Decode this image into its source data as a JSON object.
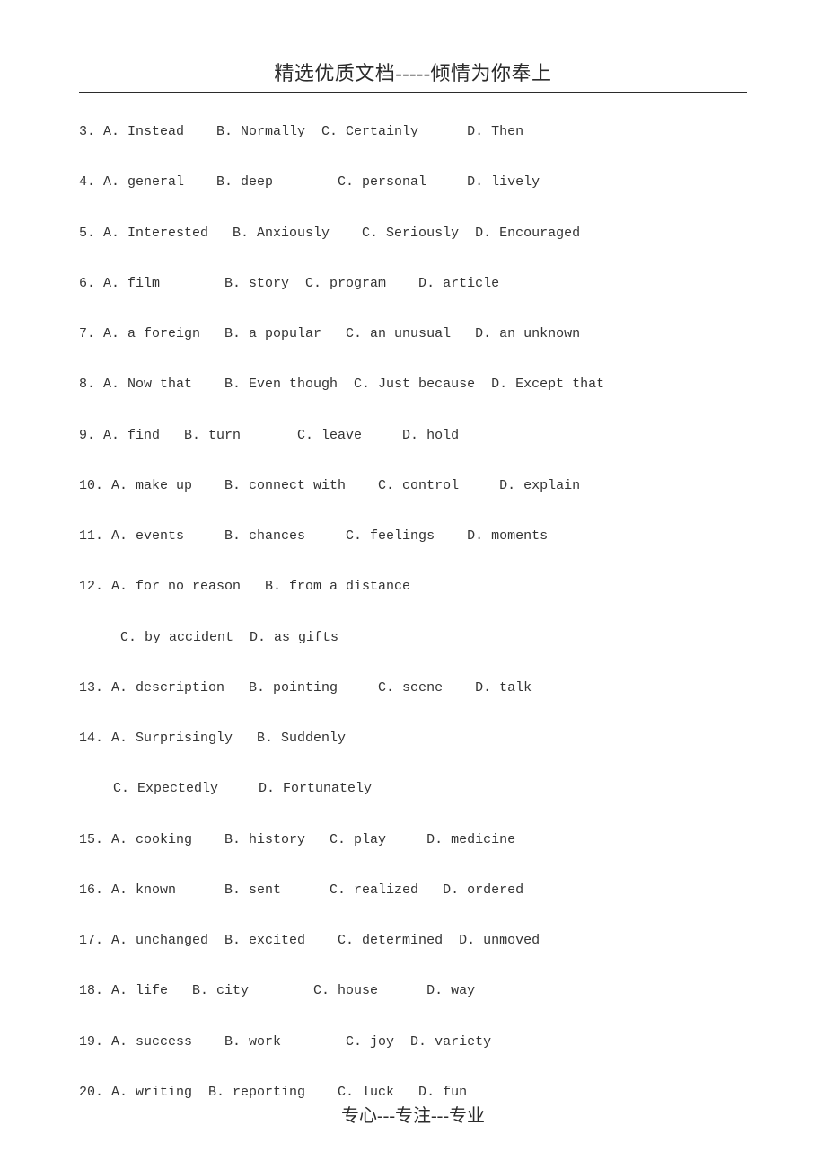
{
  "header": {
    "title": "精选优质文档-----倾情为你奉上"
  },
  "footer": {
    "text": "专心---专注---专业"
  },
  "rows": {
    "r3": "3. A. Instead    B. Normally  C. Certainly      D. Then",
    "r4": "4. A. general    B. deep        C. personal     D. lively",
    "r5": "5. A. Interested   B. Anxiously    C. Seriously  D. Encouraged",
    "r6": "6. A. film        B. story  C. program    D. article",
    "r7": "7. A. a foreign   B. a popular   C. an unusual   D. an unknown",
    "r8": "8. A. Now that    B. Even though  C. Just because  D. Except that",
    "r9": "9. A. find   B. turn       C. leave     D. hold",
    "r10": "10. A. make up    B. connect with    C. control     D. explain",
    "r11": "11. A. events     B. chances     C. feelings    D. moments",
    "r12": "12. A. for no reason   B. from a distance",
    "r12b": "C. by accident  D. as gifts",
    "r13": "13. A. description   B. pointing     C. scene    D. talk",
    "r14": "14. A. Surprisingly   B. Suddenly",
    "r14b": "C. Expectedly     D. Fortunately",
    "r15": "15. A. cooking    B. history   C. play     D. medicine",
    "r16": "16. A. known      B. sent      C. realized   D. ordered",
    "r17": "17. A. unchanged  B. excited    C. determined  D. unmoved",
    "r18": "18. A. life   B. city        C. house      D. way",
    "r19": "19. A. success    B. work        C. joy  D. variety",
    "r20": "20. A. writing  B. reporting    C. luck   D. fun"
  }
}
